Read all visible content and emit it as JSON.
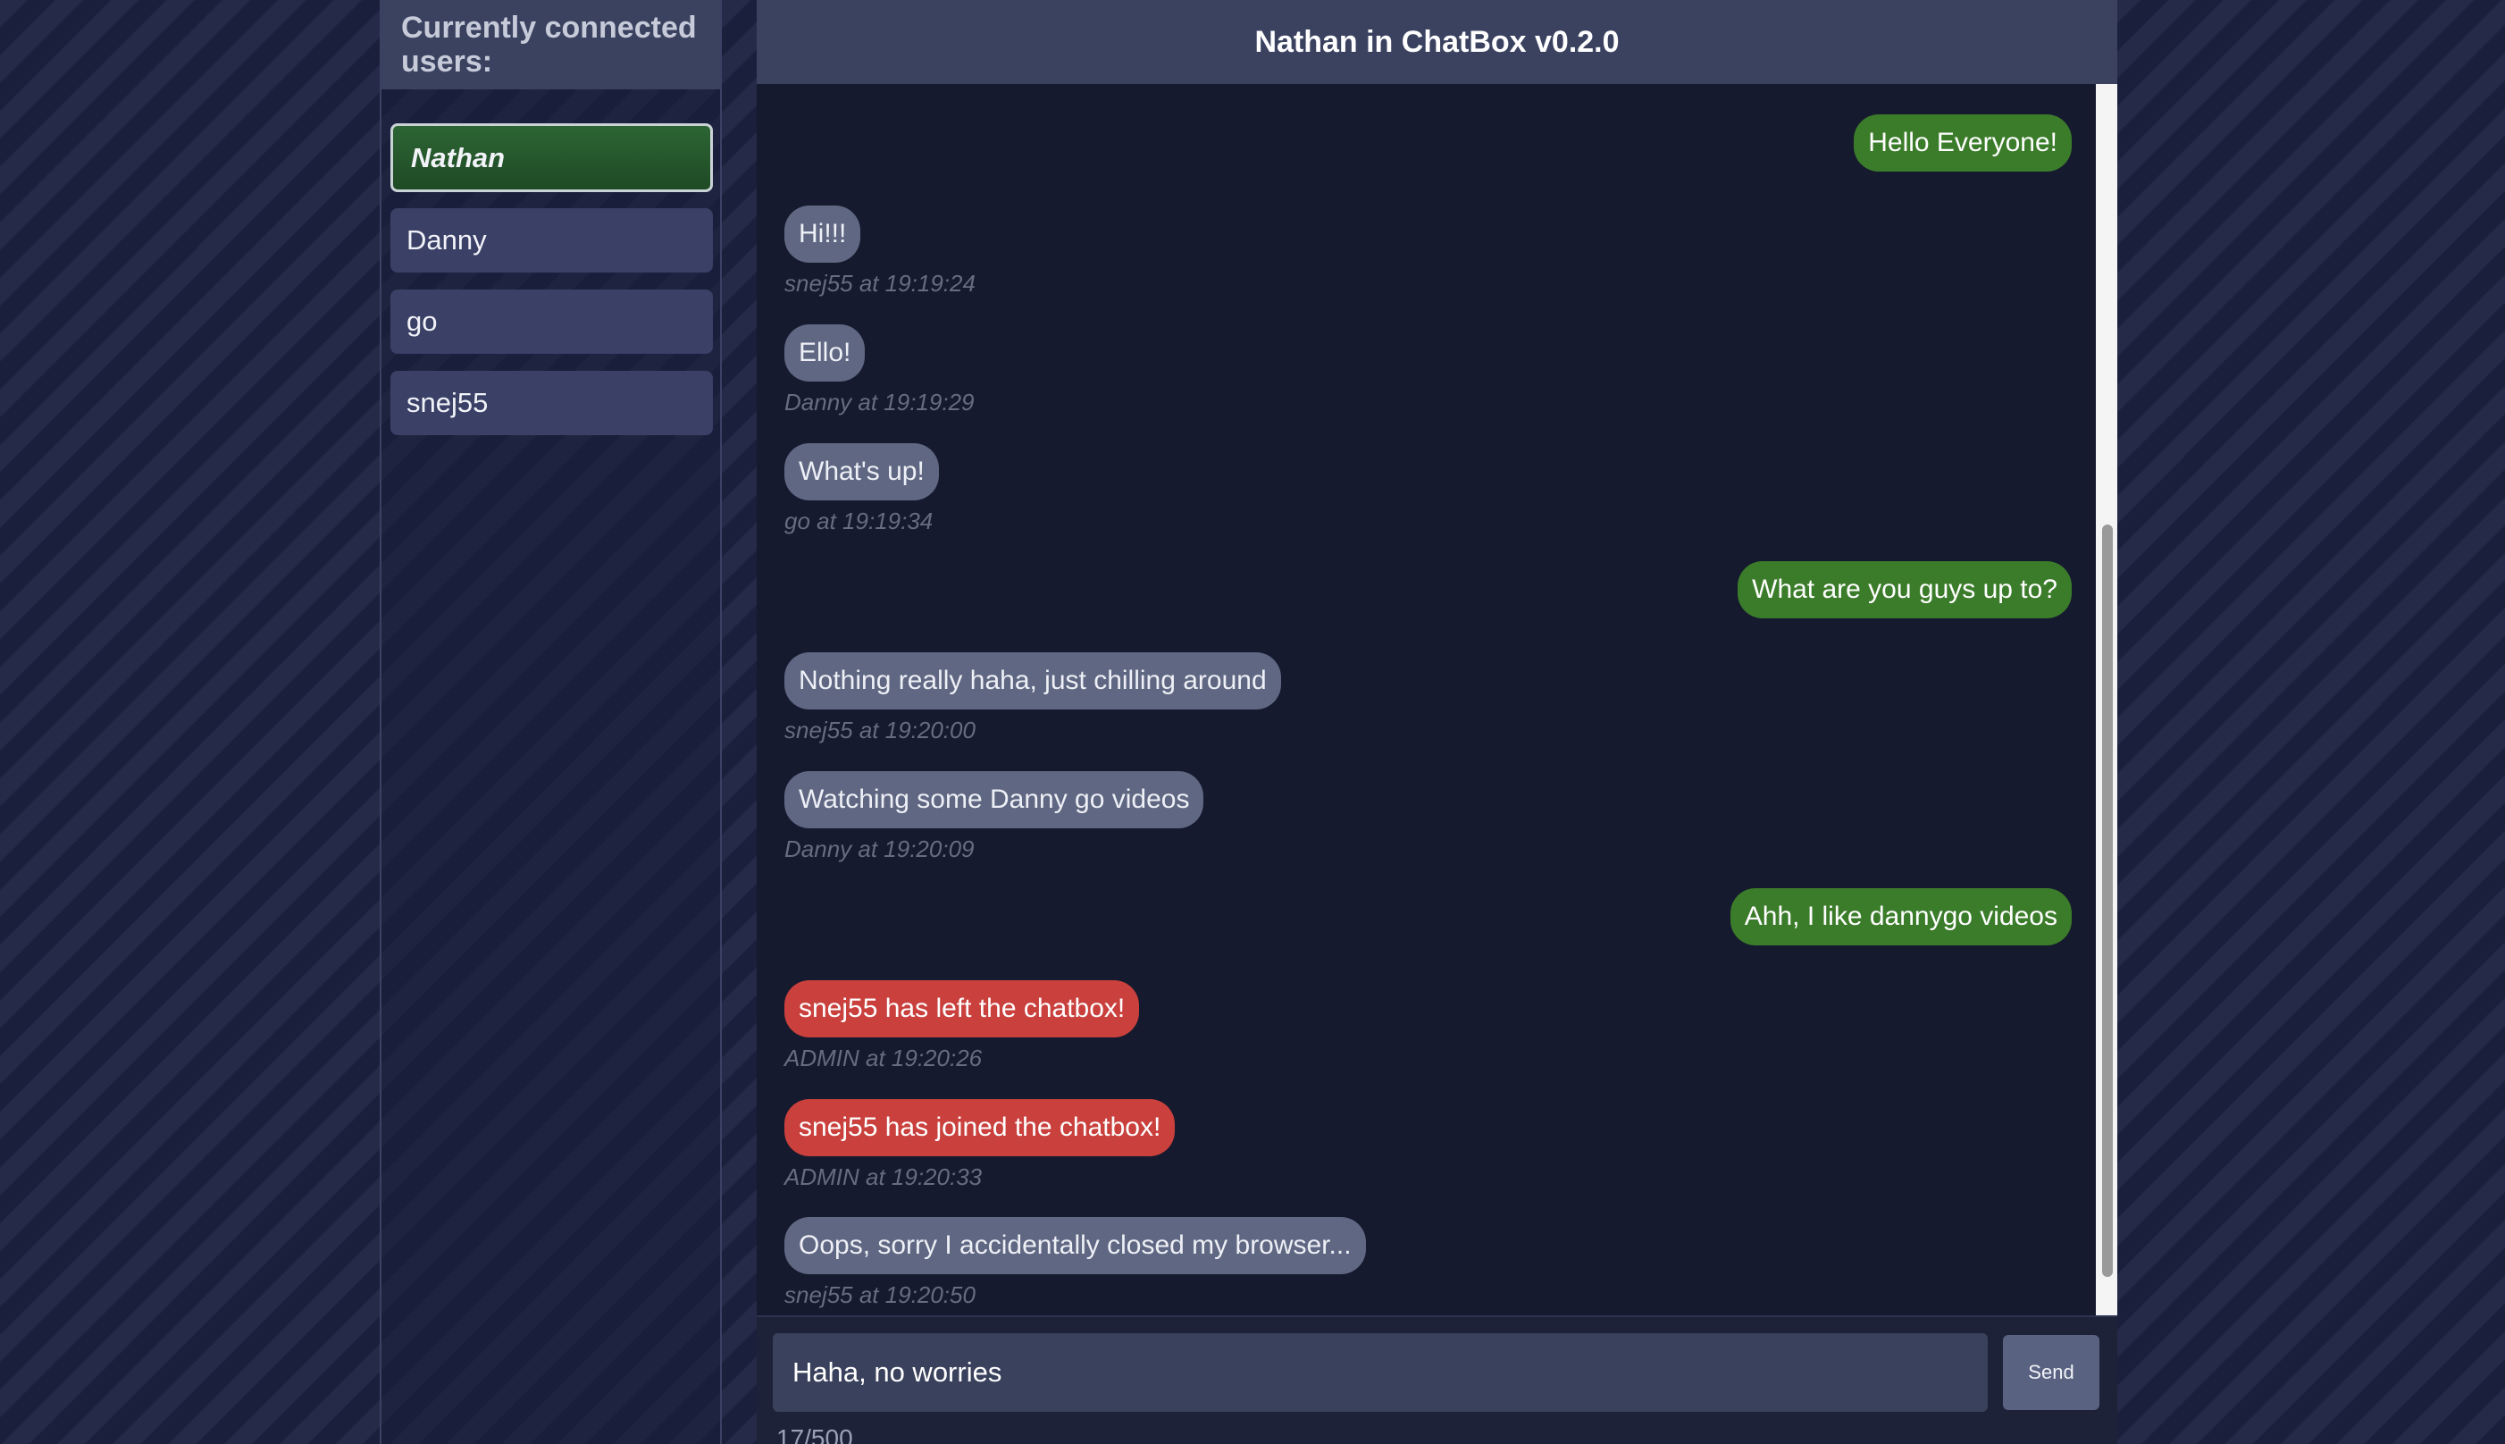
{
  "sidebar": {
    "title": "Currently connected users:",
    "users": [
      {
        "name": "Nathan",
        "is_self": true
      },
      {
        "name": "Danny",
        "is_self": false
      },
      {
        "name": "go",
        "is_self": false
      },
      {
        "name": "snej55",
        "is_self": false
      }
    ]
  },
  "chat": {
    "title": "Nathan in ChatBox v0.2.0",
    "messages": [
      {
        "text": "Hello Everyone!",
        "meta": "",
        "kind": "mine"
      },
      {
        "text": "Hi!!!",
        "meta": "snej55 at 19:19:24",
        "kind": "other"
      },
      {
        "text": "Ello!",
        "meta": "Danny at 19:19:29",
        "kind": "other"
      },
      {
        "text": "What's up!",
        "meta": "go at 19:19:34",
        "kind": "other"
      },
      {
        "text": "What are you guys up to?",
        "meta": "",
        "kind": "mine"
      },
      {
        "text": "Nothing really haha, just chilling around",
        "meta": "snej55 at 19:20:00",
        "kind": "other"
      },
      {
        "text": "Watching some Danny go videos",
        "meta": "Danny at 19:20:09",
        "kind": "other"
      },
      {
        "text": "Ahh, I like dannygo videos",
        "meta": "",
        "kind": "mine"
      },
      {
        "text": "snej55 has left the chatbox!",
        "meta": "ADMIN at 19:20:26",
        "kind": "admin"
      },
      {
        "text": "snej55 has joined the chatbox!",
        "meta": "ADMIN at 19:20:33",
        "kind": "admin"
      },
      {
        "text": "Oops, sorry I accidentally closed my browser...",
        "meta": "snej55 at 19:20:50",
        "kind": "other"
      }
    ]
  },
  "composer": {
    "input_value": "Haha, no worries",
    "send_label": "Send",
    "char_count": "17/500"
  },
  "colors": {
    "mine_bubble": "#3b7c2a",
    "other_bubble": "#5f6782",
    "admin_bubble": "#c9403d",
    "self_user": "#2d6534"
  }
}
